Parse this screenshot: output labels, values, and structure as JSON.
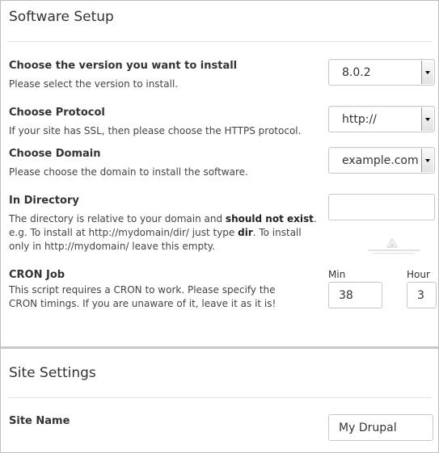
{
  "software_setup": {
    "title": "Software Setup",
    "version": {
      "label": "Choose the version you want to install",
      "help": "Please select the version to install.",
      "selected": "8.0.2"
    },
    "protocol": {
      "label": "Choose Protocol",
      "help": "If your site has SSL, then please choose the HTTPS protocol.",
      "selected": "http://"
    },
    "domain": {
      "label": "Choose Domain",
      "help": "Please choose the domain to install the software.",
      "selected": "example.com"
    },
    "directory": {
      "label": "In Directory",
      "help_part1": "The directory is relative to your domain and ",
      "help_bold1": "should not exist",
      "help_part2": ". e.g. To install at http://mydomain/dir/ just type ",
      "help_bold2": "dir",
      "help_part3": ". To install only in http://mydomain/ leave this empty.",
      "value": ""
    },
    "cron": {
      "label": "CRON Job",
      "help": "This script requires a CRON to work. Please specify the CRON timings. If you are unaware of it, leave it as it is!",
      "min_label": "Min",
      "min_value": "38",
      "hour_label": "Hour",
      "hour_value": "3"
    }
  },
  "site_settings": {
    "title": "Site Settings",
    "site_name": {
      "label": "Site Name",
      "value": "My Drupal"
    }
  }
}
